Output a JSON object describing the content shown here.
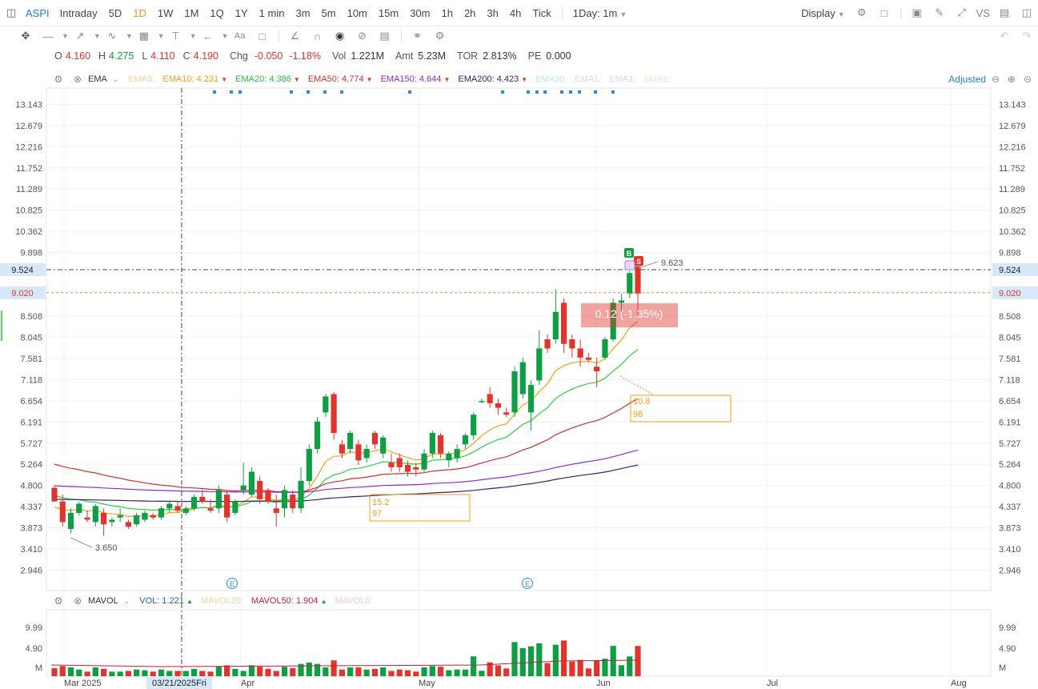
{
  "toolbar": {
    "symbol": "ASPI",
    "timeframes": [
      "Intraday",
      "5D",
      "1D",
      "1W",
      "1M",
      "1Q",
      "1Y",
      "1 min",
      "3m",
      "5m",
      "10m",
      "15m",
      "30m",
      "1h",
      "2h",
      "3h",
      "4h",
      "Tick"
    ],
    "active_timeframe": "1D",
    "interval_select": "1Day: 1m",
    "display_label": "Display",
    "vs_label": "VS"
  },
  "ohlc": {
    "o_label": "O",
    "o": "4.160",
    "h_label": "H",
    "h": "4.275",
    "l_label": "L",
    "l": "4.110",
    "c_label": "C",
    "c": "4.190",
    "chg_label": "Chg",
    "chg": "-0.050",
    "chg_pct": "-1.18%",
    "vol_label": "Vol",
    "vol": "1.221M",
    "amt_label": "Amt",
    "amt": "5.23M",
    "tor_label": "TOR",
    "tor": "2.813%",
    "pe_label": "PE",
    "pe": "0.000"
  },
  "indicators": {
    "name": "EMA",
    "ema5_label": "EMA5:",
    "ema10_label": "EMA10:",
    "ema10": "4.231",
    "ema20_label": "EMA20:",
    "ema20": "4.386",
    "ema50_label": "EMA50:",
    "ema50": "4.774",
    "ema150_label": "EMA150:",
    "ema150": "4.644",
    "ema200_label": "EMA200:",
    "ema200": "4.423",
    "ema30_label": "EMA30:",
    "ema_a_label": "EMA1:",
    "ema_b_label": "EMA1:",
    "ema_c_label": "EMA1:",
    "adjusted_label": "Adjusted"
  },
  "volume_panel": {
    "name": "MAVOL",
    "vol_label": "VOL:",
    "vol": "1.221",
    "mavol20_label": "MAVOL20:",
    "mavol50_label": "MAVOL50:",
    "mavol50": "1.904",
    "mavol0_label": "MAVOL0:",
    "axis_ticks": [
      "9.99",
      "4.90",
      "M"
    ]
  },
  "price_axis": {
    "ticks": [
      "13.143",
      "12.679",
      "12.216",
      "11.752",
      "11.289",
      "10.825",
      "10.362",
      "9.898",
      "9.524",
      "9.020",
      "8.508",
      "8.045",
      "7.581",
      "7.118",
      "6.654",
      "6.191",
      "5.727",
      "5.264",
      "4.800",
      "4.337",
      "3.873",
      "3.410",
      "2.946"
    ],
    "crosshair_label": "9.524",
    "alert_label": "9.020"
  },
  "time_axis": {
    "labels": [
      "Mar 2025",
      "Apr",
      "May",
      "Jun",
      "Jul",
      "Aug"
    ],
    "crosshair_date": "03/21/2025Fri"
  },
  "annotations": {
    "low_label": "3.650",
    "high_label": "9.623",
    "box1_l1": "15.2",
    "box1_l2": "97",
    "box2_l1": "10.8",
    "box2_l2": "98",
    "order_label": "0.12 (-1.35%)",
    "buy_marker": "B",
    "sell_marker": "S",
    "event_marker": "E"
  },
  "colors": {
    "up": "#0e9f44",
    "down": "#e0342c",
    "ema10": "#f0a21a",
    "ema20": "#2fcf3e",
    "ema50": "#d12e2e",
    "ema150": "#8a2bd4",
    "ema200": "#3b1f6b",
    "accent": "#1e7fd4"
  },
  "chart_data": {
    "type": "candlestick",
    "ylim": [
      2.946,
      13.143
    ],
    "candles": [
      {
        "o": 4.75,
        "h": 4.8,
        "l": 4.5,
        "c": 4.45
      },
      {
        "o": 4.45,
        "h": 4.6,
        "l": 3.9,
        "c": 4.0
      },
      {
        "o": 3.85,
        "h": 4.3,
        "l": 3.75,
        "c": 4.2
      },
      {
        "o": 4.2,
        "h": 4.45,
        "l": 4.15,
        "c": 4.4
      },
      {
        "o": 4.1,
        "h": 4.25,
        "l": 4.0,
        "c": 4.05
      },
      {
        "o": 4.0,
        "h": 4.4,
        "l": 3.9,
        "c": 4.35
      },
      {
        "o": 4.2,
        "h": 4.3,
        "l": 3.7,
        "c": 3.95
      },
      {
        "o": 4.0,
        "h": 4.1,
        "l": 3.9,
        "c": 4.05
      },
      {
        "o": 4.1,
        "h": 4.3,
        "l": 4.0,
        "c": 4.15
      },
      {
        "o": 4.0,
        "h": 4.05,
        "l": 3.85,
        "c": 3.9
      },
      {
        "o": 3.95,
        "h": 4.2,
        "l": 3.9,
        "c": 4.15
      },
      {
        "o": 4.05,
        "h": 4.25,
        "l": 4.0,
        "c": 4.2
      },
      {
        "o": 4.15,
        "h": 4.2,
        "l": 4.05,
        "c": 4.1
      },
      {
        "o": 4.1,
        "h": 4.35,
        "l": 4.05,
        "c": 4.3
      },
      {
        "o": 4.3,
        "h": 4.45,
        "l": 4.2,
        "c": 4.4
      },
      {
        "o": 4.35,
        "h": 4.45,
        "l": 4.2,
        "c": 4.25
      },
      {
        "o": 4.2,
        "h": 4.35,
        "l": 4.15,
        "c": 4.3
      },
      {
        "o": 4.3,
        "h": 4.6,
        "l": 4.25,
        "c": 4.55
      },
      {
        "o": 4.55,
        "h": 4.7,
        "l": 4.4,
        "c": 4.45
      },
      {
        "o": 4.3,
        "h": 4.5,
        "l": 4.2,
        "c": 4.25
      },
      {
        "o": 4.3,
        "h": 4.8,
        "l": 4.2,
        "c": 4.7
      },
      {
        "o": 4.6,
        "h": 4.7,
        "l": 4.0,
        "c": 4.1
      },
      {
        "o": 4.2,
        "h": 4.5,
        "l": 4.15,
        "c": 4.45
      },
      {
        "o": 4.7,
        "h": 5.3,
        "l": 4.6,
        "c": 4.8
      },
      {
        "o": 4.6,
        "h": 5.2,
        "l": 4.55,
        "c": 5.1
      },
      {
        "o": 4.9,
        "h": 5.0,
        "l": 4.4,
        "c": 4.5
      },
      {
        "o": 4.7,
        "h": 4.75,
        "l": 4.4,
        "c": 4.45
      },
      {
        "o": 4.3,
        "h": 4.6,
        "l": 3.9,
        "c": 4.2
      },
      {
        "o": 4.3,
        "h": 4.8,
        "l": 4.1,
        "c": 4.7
      },
      {
        "o": 4.6,
        "h": 4.7,
        "l": 4.2,
        "c": 4.3
      },
      {
        "o": 4.3,
        "h": 5.2,
        "l": 4.2,
        "c": 4.9
      },
      {
        "o": 4.9,
        "h": 5.7,
        "l": 4.8,
        "c": 5.6
      },
      {
        "o": 5.6,
        "h": 6.3,
        "l": 5.5,
        "c": 6.2
      },
      {
        "o": 6.4,
        "h": 6.8,
        "l": 6.3,
        "c": 6.75
      },
      {
        "o": 6.8,
        "h": 6.85,
        "l": 5.8,
        "c": 5.95
      },
      {
        "o": 5.7,
        "h": 5.8,
        "l": 5.4,
        "c": 5.5
      },
      {
        "o": 5.6,
        "h": 6.0,
        "l": 5.5,
        "c": 5.95
      },
      {
        "o": 5.7,
        "h": 5.8,
        "l": 5.25,
        "c": 5.35
      },
      {
        "o": 5.4,
        "h": 5.7,
        "l": 5.3,
        "c": 5.6
      },
      {
        "o": 5.95,
        "h": 6.0,
        "l": 5.6,
        "c": 5.7
      },
      {
        "o": 5.5,
        "h": 5.9,
        "l": 5.4,
        "c": 5.85
      },
      {
        "o": 5.3,
        "h": 5.5,
        "l": 5.1,
        "c": 5.2
      },
      {
        "o": 5.4,
        "h": 5.5,
        "l": 5.1,
        "c": 5.2
      },
      {
        "o": 5.25,
        "h": 5.35,
        "l": 5.0,
        "c": 5.1
      },
      {
        "o": 5.2,
        "h": 5.3,
        "l": 5.0,
        "c": 5.15
      },
      {
        "o": 5.15,
        "h": 5.6,
        "l": 5.1,
        "c": 5.5
      },
      {
        "o": 5.5,
        "h": 6.0,
        "l": 5.4,
        "c": 5.95
      },
      {
        "o": 5.9,
        "h": 5.95,
        "l": 5.4,
        "c": 5.5
      },
      {
        "o": 5.35,
        "h": 5.55,
        "l": 5.2,
        "c": 5.5
      },
      {
        "o": 5.4,
        "h": 5.7,
        "l": 5.3,
        "c": 5.6
      },
      {
        "o": 5.7,
        "h": 5.95,
        "l": 5.6,
        "c": 5.9
      },
      {
        "o": 5.9,
        "h": 6.4,
        "l": 5.8,
        "c": 6.35
      },
      {
        "o": 6.65,
        "h": 6.7,
        "l": 6.6,
        "c": 6.65
      },
      {
        "o": 6.8,
        "h": 6.95,
        "l": 6.5,
        "c": 6.6
      },
      {
        "o": 6.6,
        "h": 6.7,
        "l": 6.35,
        "c": 6.5
      },
      {
        "o": 6.4,
        "h": 6.5,
        "l": 6.3,
        "c": 6.35
      },
      {
        "o": 6.4,
        "h": 7.4,
        "l": 6.3,
        "c": 7.3
      },
      {
        "o": 6.8,
        "h": 7.6,
        "l": 6.7,
        "c": 7.5
      },
      {
        "o": 6.4,
        "h": 7.1,
        "l": 6.0,
        "c": 7.0
      },
      {
        "o": 7.1,
        "h": 8.2,
        "l": 7.0,
        "c": 7.8
      },
      {
        "o": 8.0,
        "h": 8.1,
        "l": 7.7,
        "c": 7.8
      },
      {
        "o": 8.0,
        "h": 9.1,
        "l": 7.9,
        "c": 8.6
      },
      {
        "o": 8.8,
        "h": 8.9,
        "l": 7.7,
        "c": 7.9
      },
      {
        "o": 8.0,
        "h": 8.1,
        "l": 7.6,
        "c": 7.8
      },
      {
        "o": 7.8,
        "h": 8.0,
        "l": 7.4,
        "c": 7.6
      },
      {
        "o": 7.6,
        "h": 7.7,
        "l": 7.5,
        "c": 7.55
      },
      {
        "o": 7.4,
        "h": 7.6,
        "l": 6.95,
        "c": 7.3
      },
      {
        "o": 7.6,
        "h": 8.05,
        "l": 7.55,
        "c": 8.0
      },
      {
        "o": 8.0,
        "h": 8.9,
        "l": 7.95,
        "c": 8.8
      },
      {
        "o": 8.8,
        "h": 9.0,
        "l": 8.6,
        "c": 8.85
      },
      {
        "o": 9.0,
        "h": 9.5,
        "l": 8.9,
        "c": 9.45
      },
      {
        "o": 9.6,
        "h": 9.62,
        "l": 8.5,
        "c": 9.0
      }
    ]
  }
}
